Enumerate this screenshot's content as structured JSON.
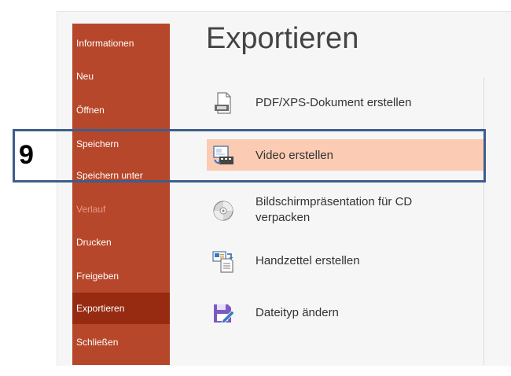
{
  "sidebar": {
    "items": [
      {
        "label": "Informationen"
      },
      {
        "label": "Neu"
      },
      {
        "label": "Öffnen"
      },
      {
        "label": "Speichern"
      },
      {
        "label": "Speichern unter"
      },
      {
        "label": "Verlauf"
      },
      {
        "label": "Drucken"
      },
      {
        "label": "Freigeben"
      },
      {
        "label": "Exportieren"
      },
      {
        "label": "Schließen"
      }
    ]
  },
  "main": {
    "title": "Exportieren",
    "options": [
      {
        "label": "PDF/XPS-Dokument erstellen",
        "icon": "pdf-document-icon"
      },
      {
        "label": "Video erstellen",
        "icon": "video-icon"
      },
      {
        "label": "Bildschirmpräsentation für CD verpacken",
        "icon": "cd-icon"
      },
      {
        "label": "Handzettel erstellen",
        "icon": "handout-icon"
      },
      {
        "label": "Dateityp ändern",
        "icon": "save-as-icon"
      }
    ]
  },
  "callout": {
    "number": "9"
  },
  "colors": {
    "sidebar": "#b7472a",
    "sidebar_active": "#962b12",
    "selection": "#fbcbb3",
    "callout_border": "#3d5e8c"
  }
}
